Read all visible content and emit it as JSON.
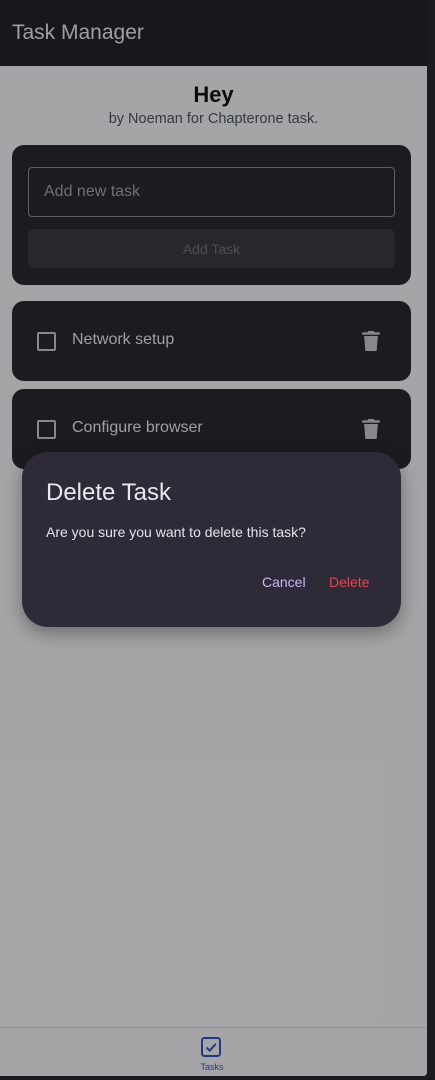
{
  "app": {
    "title": "Task Manager"
  },
  "header": {
    "greeting": "Hey",
    "subtitle": "by Noeman for Chapterone task."
  },
  "add_task": {
    "placeholder": "Add new task",
    "value": "",
    "button_label": "Add Task"
  },
  "tasks": [
    {
      "title": "Network setup",
      "done": false
    },
    {
      "title": "Configure browser",
      "done": false
    }
  ],
  "dialog": {
    "title": "Delete Task",
    "message": "Are you sure you want to delete this task?",
    "cancel_label": "Cancel",
    "delete_label": "Delete"
  },
  "bottom_nav": {
    "items": [
      {
        "label": "Tasks",
        "icon": "check-box-icon",
        "active": true
      }
    ]
  },
  "colors": {
    "appbar": "#24232a",
    "card": "#2a2930",
    "dialog": "#2e2a37",
    "cancel": "#c8b8f2",
    "delete": "#e5484d",
    "nav_active": "#3552c4"
  }
}
